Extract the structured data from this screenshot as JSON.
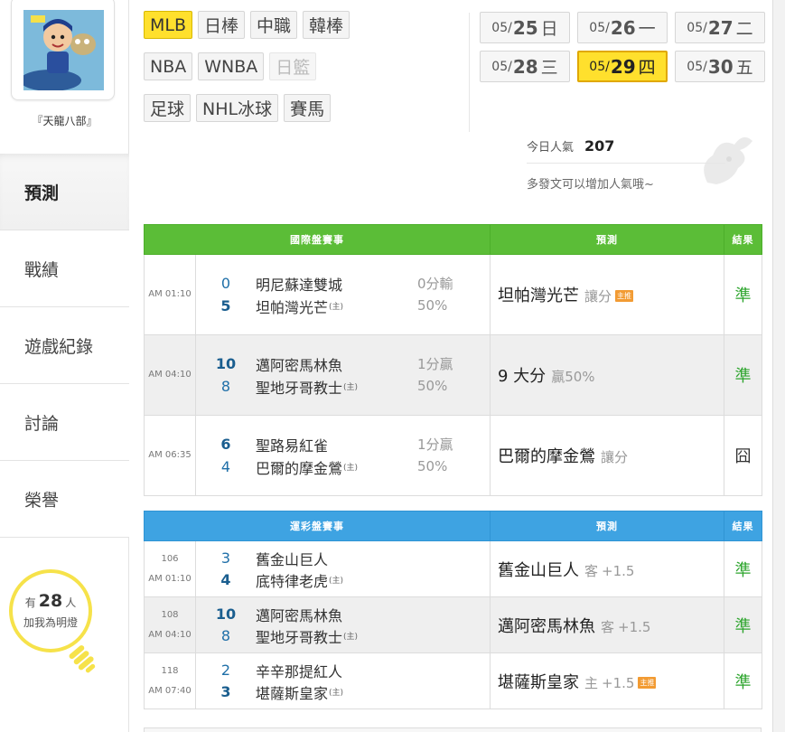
{
  "user": {
    "name": "『天龍八部』"
  },
  "nav": [
    {
      "label": "預測",
      "active": true
    },
    {
      "label": "戰績"
    },
    {
      "label": "遊戲紀錄"
    },
    {
      "label": "討論"
    },
    {
      "label": "榮譽"
    }
  ],
  "fans": {
    "prefix": "有",
    "count": "28",
    "suffix": "人",
    "line2": "加我為明燈"
  },
  "sports": {
    "row1": [
      "MLB",
      "日棒",
      "中職",
      "韓棒"
    ],
    "row2": [
      "NBA",
      "WNBA",
      "日籃"
    ],
    "row3": [
      "足球",
      "NHL冰球",
      "賽馬"
    ],
    "active": "MLB",
    "disabled": "日籃"
  },
  "dates": [
    {
      "m": "05/",
      "d": "25",
      "w": "日"
    },
    {
      "m": "05/",
      "d": "26",
      "w": "一"
    },
    {
      "m": "05/",
      "d": "27",
      "w": "二"
    },
    {
      "m": "05/",
      "d": "28",
      "w": "三"
    },
    {
      "m": "05/",
      "d": "29",
      "w": "四",
      "active": true
    },
    {
      "m": "05/",
      "d": "30",
      "w": "五"
    }
  ],
  "popularity": {
    "label": "今日人氣",
    "value": "207",
    "hint": "多發文可以增加人氣哦~"
  },
  "intl": {
    "headers": [
      "國際盤賽事",
      "預測",
      "結果"
    ],
    "rows": [
      {
        "time": "AM 01:10",
        "s1": "0",
        "t1": "明尼蘇達雙城",
        "s2": "5",
        "t2": "坦帕灣光芒",
        "home": "(主)",
        "spread1": "0分輸",
        "spread2": "50%",
        "pred": "坦帕灣光芒",
        "pred_sub": "讓分",
        "badge": "主推",
        "result": "準"
      },
      {
        "time": "AM 04:10",
        "s1": "10",
        "t1": "邁阿密馬林魚",
        "s2": "8",
        "t2": "聖地牙哥教士",
        "home": "(主)",
        "spread1": "1分贏",
        "spread2": "50%",
        "pred": "9 大分",
        "pred_sub": "贏50%",
        "result": "準"
      },
      {
        "time": "AM 06:35",
        "s1": "6",
        "t1": "聖路易紅雀",
        "s2": "4",
        "t2": "巴爾的摩金鶯",
        "home": "(主)",
        "spread1": "1分贏",
        "spread2": "50%",
        "pred": "巴爾的摩金鶯",
        "pred_sub": "讓分",
        "result": "囧"
      }
    ]
  },
  "lottery": {
    "headers": [
      "運彩盤賽事",
      "預測",
      "結果"
    ],
    "rows": [
      {
        "no": "106",
        "time": "AM 01:10",
        "s1": "3",
        "t1": "舊金山巨人",
        "s2": "4",
        "t2": "底特律老虎",
        "home": "(主)",
        "pred": "舊金山巨人",
        "pred_side": "客",
        "pred_sub": "+1.5",
        "result": "準"
      },
      {
        "no": "108",
        "time": "AM 04:10",
        "s1": "10",
        "t1": "邁阿密馬林魚",
        "s2": "8",
        "t2": "聖地牙哥教士",
        "home": "(主)",
        "pred": "邁阿密馬林魚",
        "pred_side": "客",
        "pred_sub": "+1.5",
        "result": "準"
      },
      {
        "no": "118",
        "time": "AM 07:40",
        "s1": "2",
        "t1": "辛辛那提紅人",
        "s2": "3",
        "t2": "堪薩斯皇家",
        "home": "(主)",
        "pred": "堪薩斯皇家",
        "pred_side": "主",
        "pred_sub": "+1.5",
        "badge": "主推",
        "result": "準"
      }
    ]
  },
  "colors": {
    "green_header": "#5bbd37",
    "blue_header": "#3ea3e2",
    "active_tag": "#ffe02d",
    "win_mark": "#2ea52e"
  }
}
